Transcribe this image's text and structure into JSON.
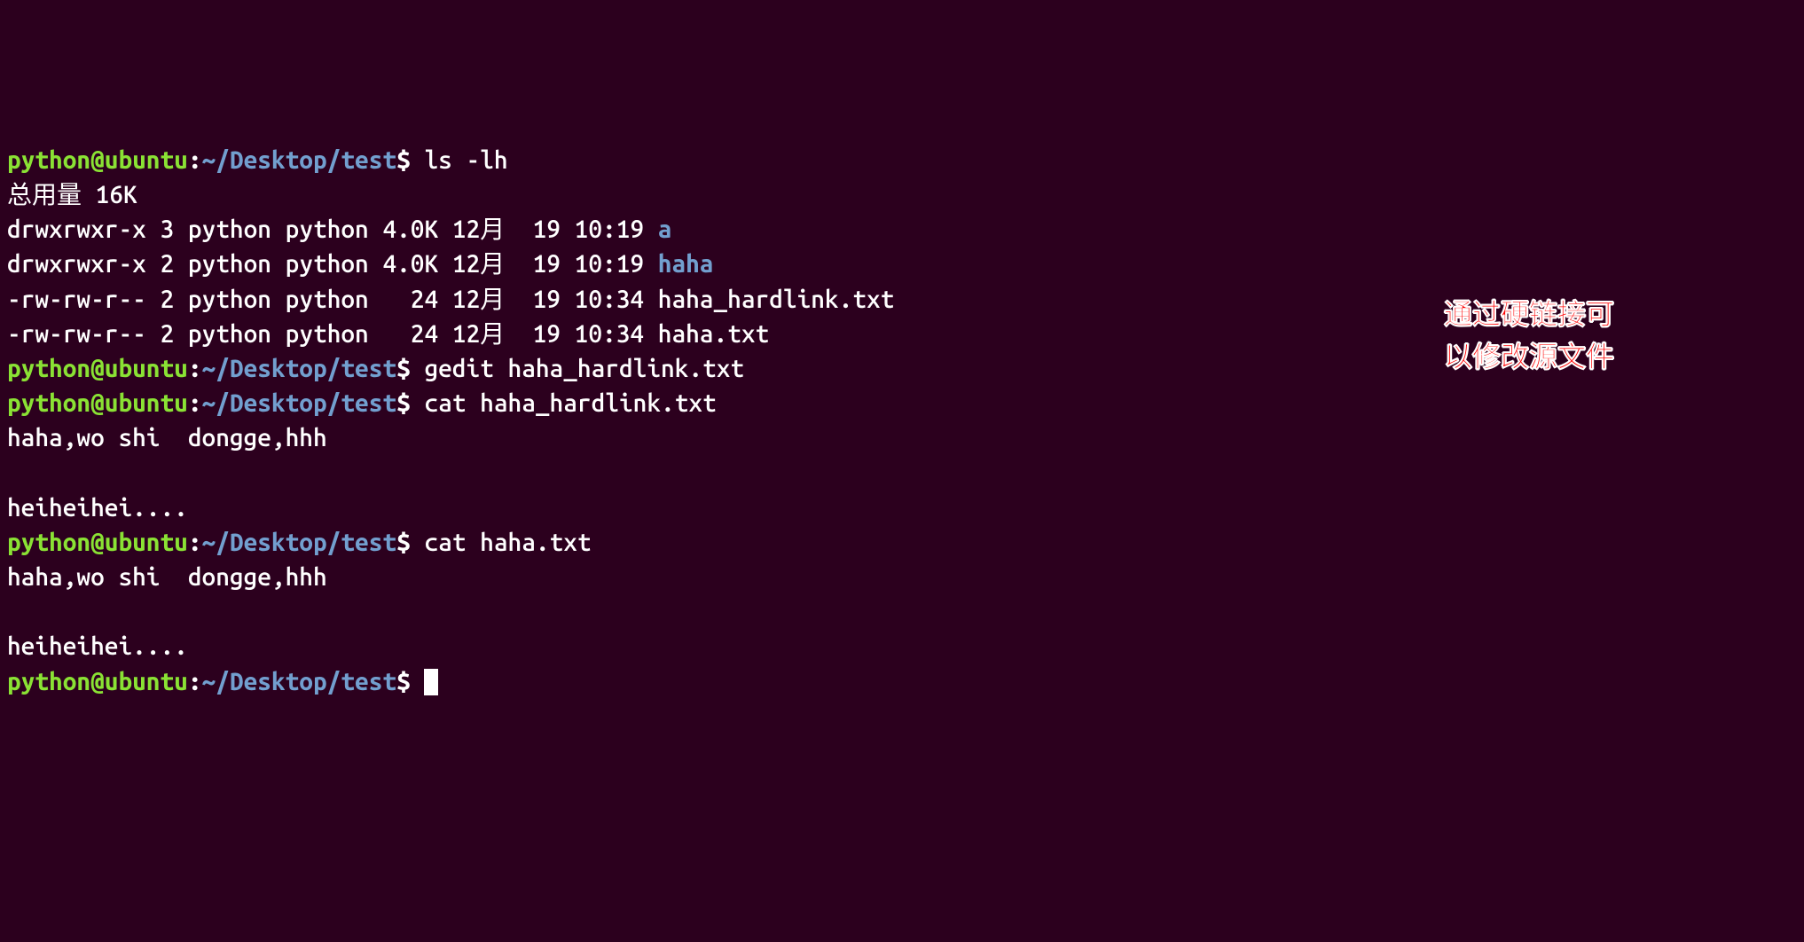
{
  "prompt": {
    "user": "python@ubuntu",
    "colon": ":",
    "path": "~/Desktop/test",
    "dollar": "$"
  },
  "commands": {
    "cmd1": "ls -lh",
    "cmd2": "gedit haha_hardlink.txt",
    "cmd3": "cat haha_hardlink.txt",
    "cmd4": "cat haha.txt"
  },
  "ls": {
    "total": "总用量 16K",
    "rows": [
      {
        "perm": "drwxrwxr-x",
        "links": "3",
        "owner": "python",
        "group": "python",
        "size": "4.0K",
        "month": "12月",
        "day": "19",
        "time": "10:19",
        "name": "a",
        "isdir": true
      },
      {
        "perm": "drwxrwxr-x",
        "links": "2",
        "owner": "python",
        "group": "python",
        "size": "4.0K",
        "month": "12月",
        "day": "19",
        "time": "10:19",
        "name": "haha",
        "isdir": true
      },
      {
        "perm": "-rw-rw-r--",
        "links": "2",
        "owner": "python",
        "group": "python",
        "size": "  24",
        "month": "12月",
        "day": "19",
        "time": "10:34",
        "name": "haha_hardlink.txt",
        "isdir": false
      },
      {
        "perm": "-rw-rw-r--",
        "links": "2",
        "owner": "python",
        "group": "python",
        "size": "  24",
        "month": "12月",
        "day": "19",
        "time": "10:34",
        "name": "haha.txt",
        "isdir": false
      }
    ]
  },
  "cat_output": {
    "line1": "haha,wo shi  dongge,hhh",
    "line2": "",
    "line3": "heiheihei...."
  },
  "annotation": {
    "line1": "通过硬链接可",
    "line2": "以修改源文件"
  }
}
